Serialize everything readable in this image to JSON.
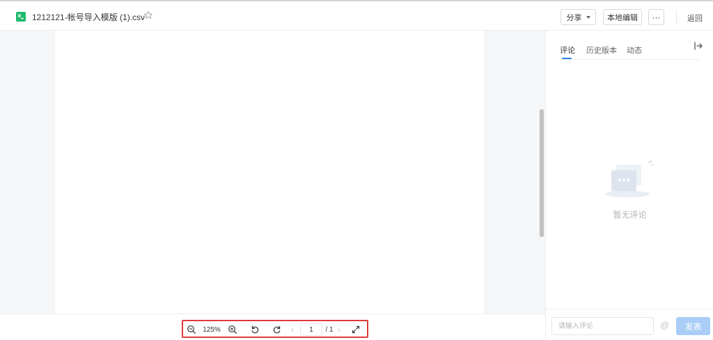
{
  "header": {
    "file_name": "1212121-帐号导入模版 (1).csv",
    "file_icon": "spreadsheet-icon",
    "share_label": "分享",
    "local_edit_label": "本地编辑",
    "more_label": "···",
    "back_label": "返回"
  },
  "toolbar": {
    "zoom_level": "125%",
    "page_current": "1",
    "page_total": "/ 1",
    "prev_glyph": "‹",
    "next_glyph": "›"
  },
  "sidebar": {
    "tabs": [
      {
        "label": "评论",
        "active": true
      },
      {
        "label": "历史版本",
        "active": false
      },
      {
        "label": "动态",
        "active": false
      }
    ],
    "empty_text": "暂无评论",
    "comment_placeholder": "请输入评论",
    "at_label": "@",
    "post_label": "发表"
  },
  "colors": {
    "accent": "#2f80ed",
    "file_icon_green": "#1fba6e",
    "highlight_border": "#e03a3a",
    "post_button_disabled": "#a9cdf7"
  }
}
